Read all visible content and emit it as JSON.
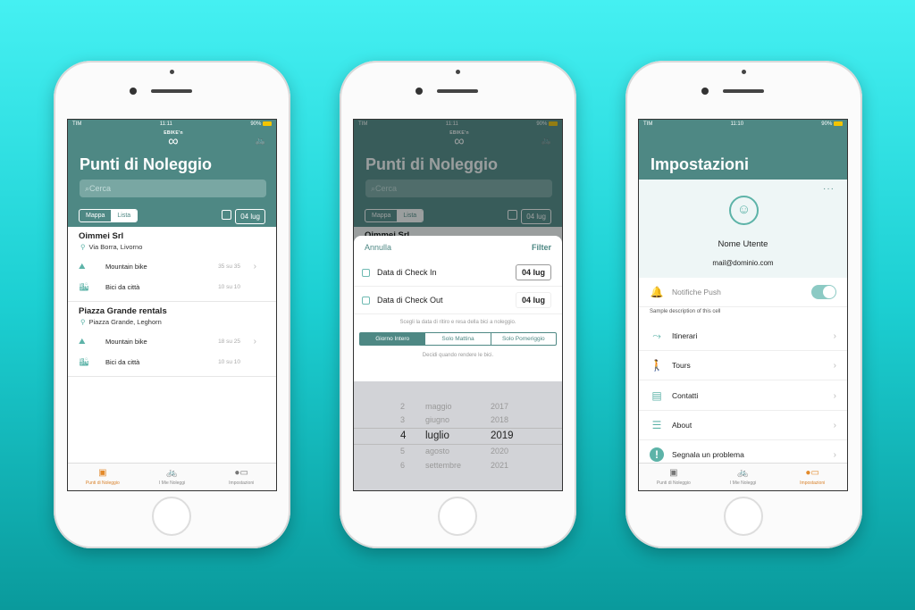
{
  "colors": {
    "brand": "#4e8884",
    "accent": "#5db3a8",
    "active_tab": "#e38a2b"
  },
  "status": {
    "carrier": "TIM",
    "battery": "90%",
    "time1": "11:11",
    "time2": "11:11",
    "time3": "11:10"
  },
  "logo_text": "EBIKE'n",
  "tabs": [
    {
      "label": "Punti di Noleggio",
      "icon": "rental-point-icon"
    },
    {
      "label": "I Mie Noleggi",
      "icon": "bike-icon"
    },
    {
      "label": "Impostazioni",
      "icon": "toggle-icon"
    }
  ],
  "screen1": {
    "title": "Punti di Noleggio",
    "search_placeholder": "Cerca",
    "view_toggle": [
      "Mappa",
      "Lista"
    ],
    "selected_view": "Lista",
    "date": "04 lug",
    "shops": [
      {
        "name": "Oimmei Srl",
        "address": "Via Borra, Livorno",
        "bikes": [
          {
            "type": "Mountain bike",
            "count": "35 su 35"
          },
          {
            "type": "Bici da città",
            "count": "10 su 10"
          }
        ]
      },
      {
        "name": "Piazza Grande rentals",
        "address": "Piazza Grande, Leghorn",
        "bikes": [
          {
            "type": "Mountain bike",
            "count": "18 su 25"
          },
          {
            "type": "Bici da città",
            "count": "10 su 10"
          }
        ]
      }
    ]
  },
  "screen2": {
    "title": "Punti di Noleggio",
    "search_placeholder": "Cerca",
    "view_toggle": [
      "Mappa",
      "Lista"
    ],
    "date": "04 lug",
    "peek_shop": "Oimmei Srl",
    "cancel": "Annulla",
    "filter": "Filter",
    "check_in_label": "Data di Check In",
    "check_in_value": "04 lug",
    "check_out_label": "Data di Check Out",
    "check_out_value": "04 lug",
    "hint1": "Scegli la data di ritiro e resa della bici a noleggio.",
    "time_options": [
      "Giorno Intero",
      "Solo Mattina",
      "Solo Pomeriggio"
    ],
    "selected_time": "Giorno Intero",
    "hint2": "Decidi quando rendere le bici.",
    "picker": [
      {
        "d": "2",
        "m": "maggio",
        "y": "2017"
      },
      {
        "d": "3",
        "m": "giugno",
        "y": "2018"
      },
      {
        "d": "4",
        "m": "luglio",
        "y": "2019"
      },
      {
        "d": "5",
        "m": "agosto",
        "y": "2020"
      },
      {
        "d": "6",
        "m": "settembre",
        "y": "2021"
      }
    ]
  },
  "screen3": {
    "title": "Impostazioni",
    "user_name": "Nome Utente",
    "email": "mail@dominio.com",
    "push_label": "Notifiche Push",
    "push_enabled": true,
    "description": "Sample description of this cell",
    "items": [
      {
        "label": "Itinerari",
        "icon": "route-icon"
      },
      {
        "label": "Tours",
        "icon": "tour-guide-icon"
      },
      {
        "label": "Contatti",
        "icon": "contact-book-icon"
      },
      {
        "label": "About",
        "icon": "document-icon"
      },
      {
        "label": "Segnala un problema",
        "icon": "alert-icon"
      }
    ]
  }
}
